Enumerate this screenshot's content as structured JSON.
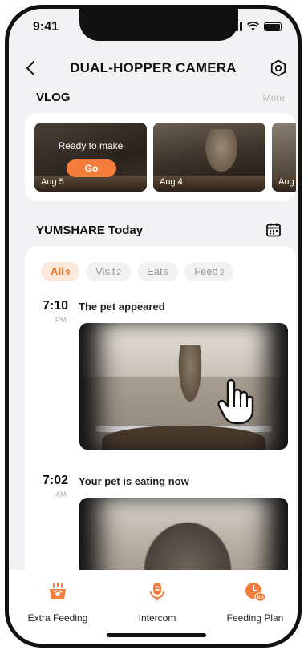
{
  "status": {
    "time": "9:41"
  },
  "header": {
    "title": "DUAL-HOPPER CAMERA"
  },
  "vlog": {
    "title": "VLOG",
    "more_label": "More",
    "items": [
      {
        "date": "Aug 5",
        "overlay_text": "Ready to make",
        "button_label": "Go"
      },
      {
        "date": "Aug 4"
      },
      {
        "date": "Aug"
      }
    ]
  },
  "today": {
    "title": "YUMSHARE Today",
    "filters": [
      {
        "label": "All",
        "count": "9",
        "active": true
      },
      {
        "label": "Visit",
        "count": "2"
      },
      {
        "label": "Eat",
        "count": "5"
      },
      {
        "label": "Feed",
        "count": "2"
      }
    ],
    "events": [
      {
        "time": "7:10",
        "ampm": "PM",
        "text": "The pet appeared"
      },
      {
        "time": "7:02",
        "ampm": "AM",
        "text": "Your pet is eating now"
      }
    ]
  },
  "bottom_nav": [
    {
      "label": "Extra Feeding",
      "icon": "paw-feeding-icon"
    },
    {
      "label": "Intercom",
      "icon": "microphone-icon"
    },
    {
      "label": "Feeding Plan",
      "icon": "clock-on-icon",
      "badge": "on"
    }
  ],
  "colors": {
    "accent": "#f47d3c",
    "chip_active_bg": "#fde9dc",
    "background": "#f2f2f5"
  }
}
